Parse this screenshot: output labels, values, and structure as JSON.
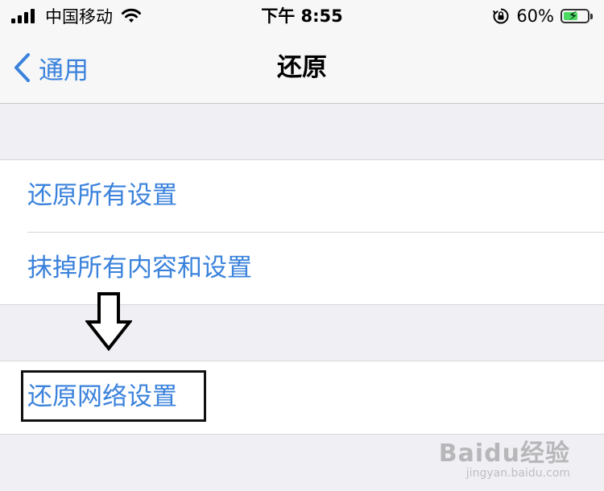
{
  "status_bar": {
    "carrier": "中国移动",
    "time": "下午 8:55",
    "battery_percent": "60%",
    "battery_level": 0.6,
    "icons": [
      "signal-icon",
      "wifi-icon",
      "orientation-lock-icon",
      "battery-charging-icon"
    ]
  },
  "nav": {
    "back_label": "通用",
    "title": "还原"
  },
  "groups": [
    {
      "items": [
        {
          "label": "还原所有设置"
        },
        {
          "label": "抹掉所有内容和设置"
        }
      ]
    },
    {
      "items": [
        {
          "label": "还原网络设置"
        }
      ]
    }
  ],
  "annotation": {
    "icon": "down-arrow-icon",
    "highlighted_item": "还原网络设置"
  },
  "watermark": {
    "logo": "Baidu经验",
    "sub": "jingyan.baidu.com"
  },
  "colors": {
    "accent": "#3a82dc",
    "background": "#efeff4",
    "battery": "#4cd964"
  }
}
